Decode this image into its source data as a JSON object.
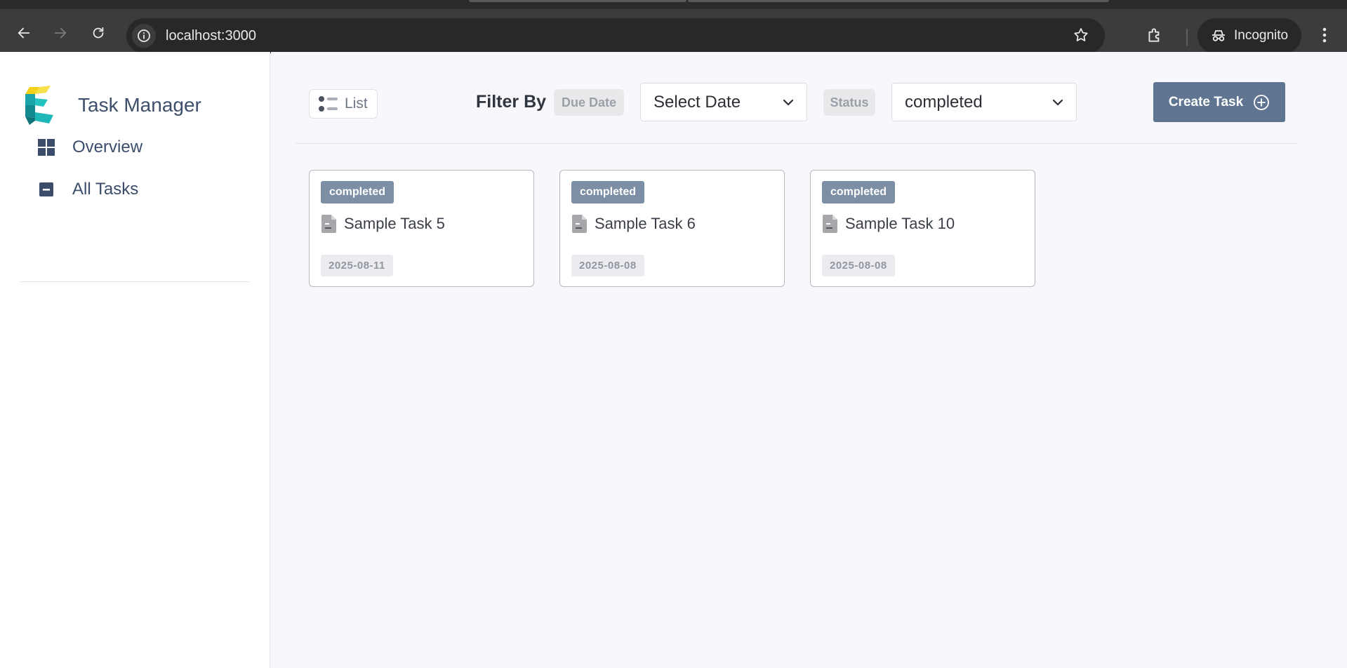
{
  "browser": {
    "url": "localhost:3000",
    "profile_label": "Incognito"
  },
  "sidebar": {
    "app_name": "Task Manager",
    "items": [
      {
        "label": "Overview",
        "icon": "grid-icon"
      },
      {
        "label": "All Tasks",
        "icon": "minus-square-icon"
      }
    ]
  },
  "toolbar": {
    "view_toggle_label": "List",
    "filter_label": "Filter By",
    "due_date_chip": "Due Date",
    "date_select_value": "Select Date",
    "status_chip": "Status",
    "status_select_value": "completed",
    "create_label": "Create Task"
  },
  "tasks": [
    {
      "status": "completed",
      "title": "Sample Task 5",
      "date": "2025-08-11"
    },
    {
      "status": "completed",
      "title": "Sample Task 6",
      "date": "2025-08-08"
    },
    {
      "status": "completed",
      "title": "Sample Task 10",
      "date": "2025-08-08"
    }
  ],
  "colors": {
    "accent": "#5f7591",
    "badge": "#7d8fa4",
    "sidebar_text": "#3b4d6a"
  }
}
